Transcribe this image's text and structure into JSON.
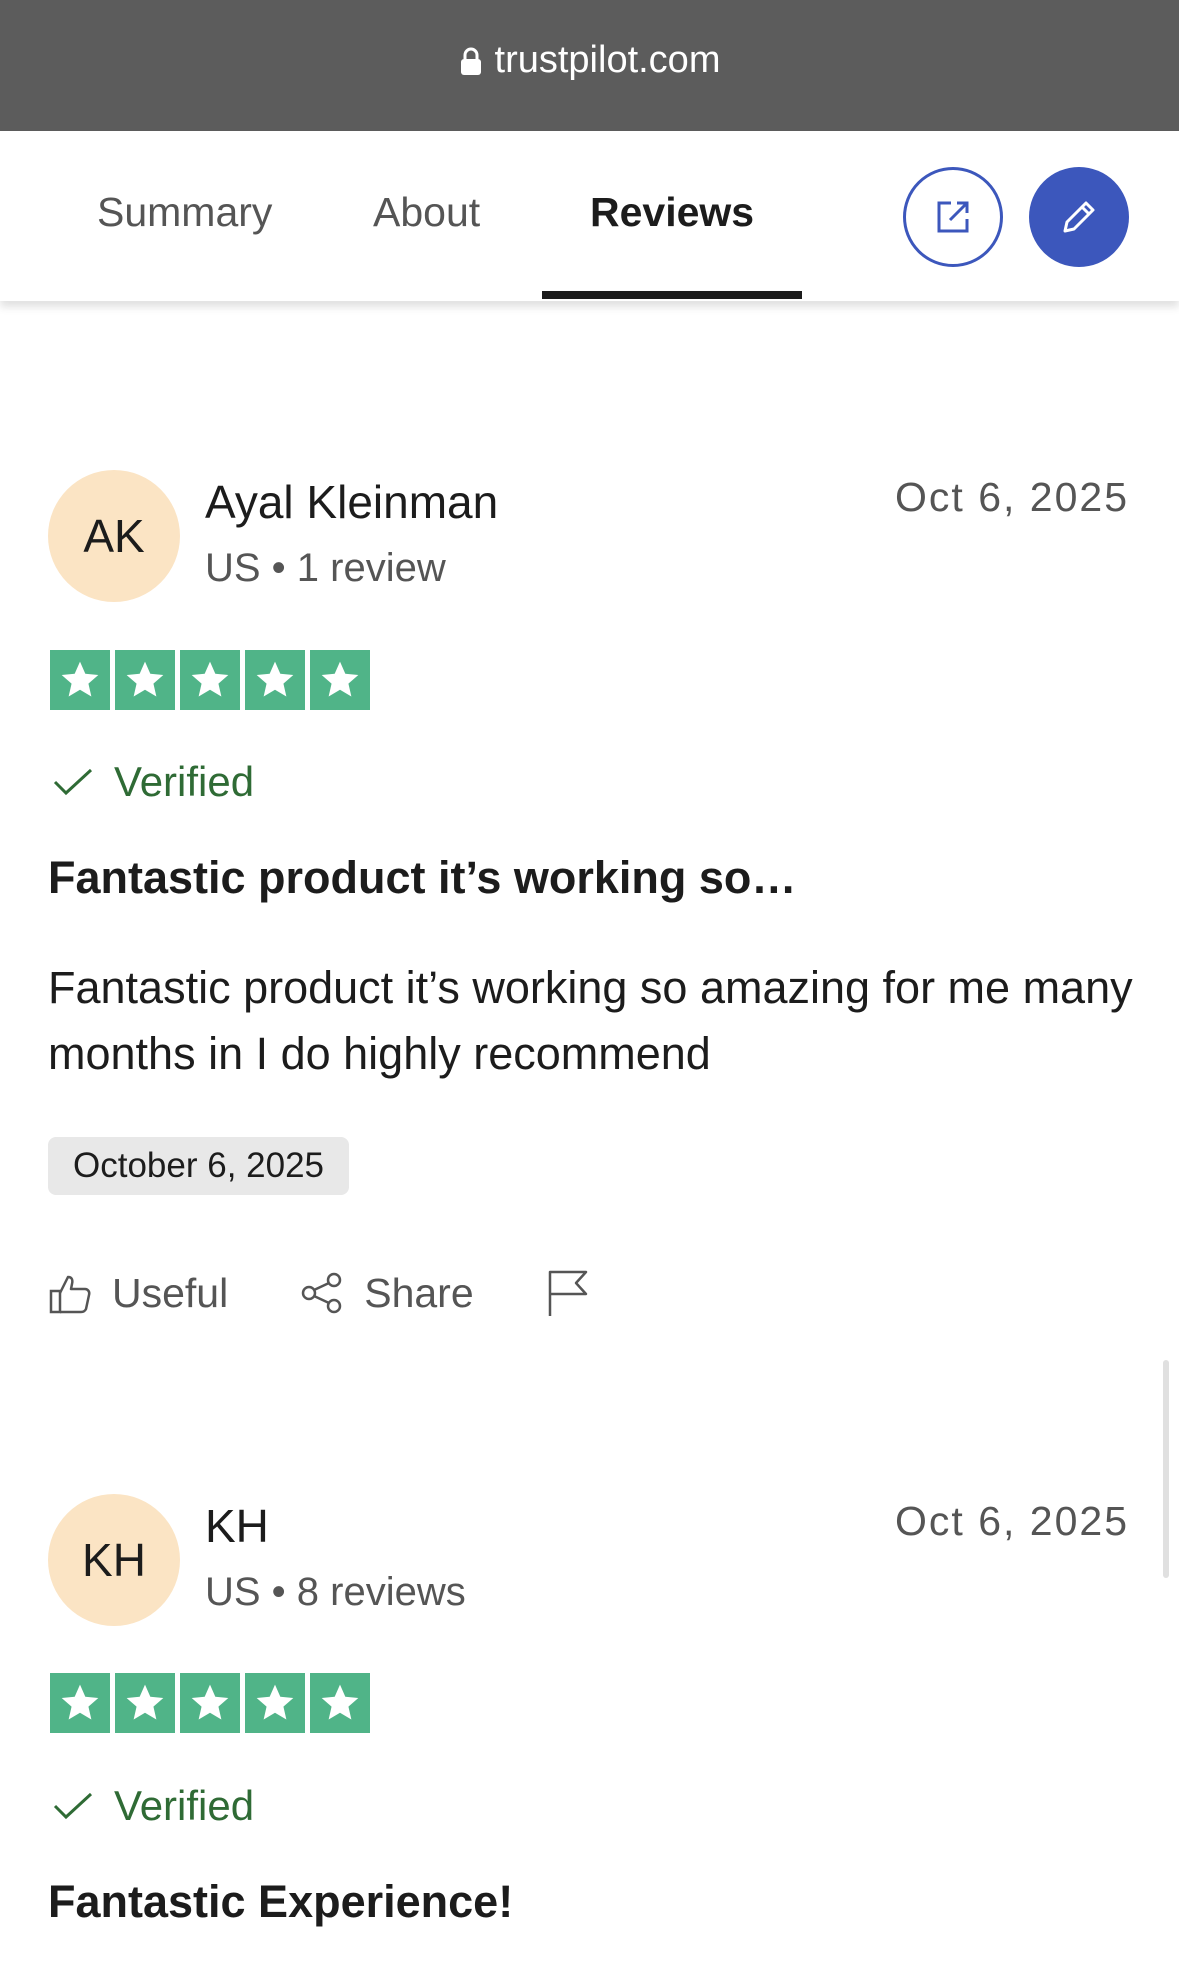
{
  "browser": {
    "url": "trustpilot.com"
  },
  "tabs": [
    {
      "label": "Summary",
      "active": false
    },
    {
      "label": "About",
      "active": false
    },
    {
      "label": "Reviews",
      "active": true
    }
  ],
  "header_buttons": {
    "open": "external-link-icon",
    "write": "pencil-icon"
  },
  "colors": {
    "brand_blue": "#3c57bc",
    "star_green": "#50b488",
    "verified_green": "#2f6b35",
    "avatar_bg": "#fbe4c4"
  },
  "reviews": [
    {
      "initials": "AK",
      "name": "Ayal Kleinman",
      "meta": "US • 1 review",
      "date": "Oct 6, 2025",
      "rating": 5,
      "verified": "Verified",
      "title": "Fantastic product it’s working so…",
      "body": "Fantastic product it’s working so amazing for me many months in I do highly recommend",
      "experience_date": "October 6, 2025",
      "actions": {
        "useful": "Useful",
        "share": "Share"
      }
    },
    {
      "initials": "KH",
      "name": "KH",
      "meta": "US • 8 reviews",
      "date": "Oct 6, 2025",
      "rating": 5,
      "verified": "Verified",
      "title": "Fantastic Experience!"
    }
  ]
}
